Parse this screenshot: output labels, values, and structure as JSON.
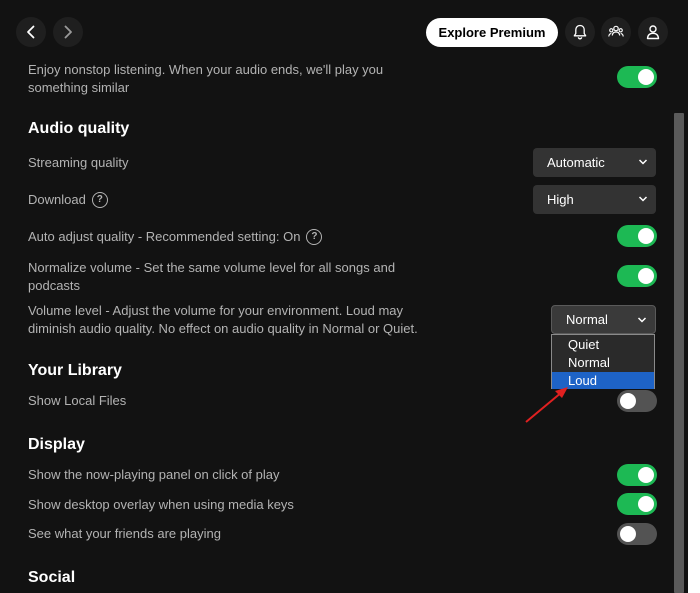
{
  "topbar": {
    "explore_label": "Explore Premium"
  },
  "settings": {
    "autoplay_line1": "Enjoy nonstop listening. When your audio ends, we'll play you",
    "autoplay_line2": "something similar",
    "audio_quality_heading": "Audio quality",
    "streaming_label": "Streaming quality",
    "streaming_value": "Automatic",
    "download_label": "Download",
    "download_value": "High",
    "auto_adjust_label": "Auto adjust quality - Recommended setting: On",
    "normalize_line1": "Normalize volume - Set the same volume level for all songs and",
    "normalize_line2": "podcasts",
    "volume_line1": "Volume level - Adjust the volume for your environment. Loud may",
    "volume_line2": "diminish audio quality. No effect on audio quality in Normal or Quiet.",
    "volume_value": "Normal",
    "volume_options": [
      "Quiet",
      "Normal",
      "Loud"
    ],
    "library_heading": "Your Library",
    "local_files_label": "Show Local Files",
    "display_heading": "Display",
    "now_playing_label": "Show the now-playing panel on click of play",
    "overlay_label": "Show desktop overlay when using media keys",
    "friends_label": "See what your friends are playing",
    "social_heading": "Social",
    "help_glyph": "?"
  },
  "toggles": {
    "autoplay": true,
    "auto_adjust": true,
    "normalize": true,
    "local_files": false,
    "now_playing": true,
    "overlay": true,
    "friends": false
  },
  "colors": {
    "background": "#121212",
    "accent_green": "#1db954",
    "dropdown_highlight": "#1e63c6",
    "annotation_arrow": "#e02020"
  },
  "icons": [
    "back-icon",
    "forward-icon",
    "bell-icon",
    "friends-icon",
    "user-icon",
    "help-icon",
    "chevron-down-icon"
  ]
}
